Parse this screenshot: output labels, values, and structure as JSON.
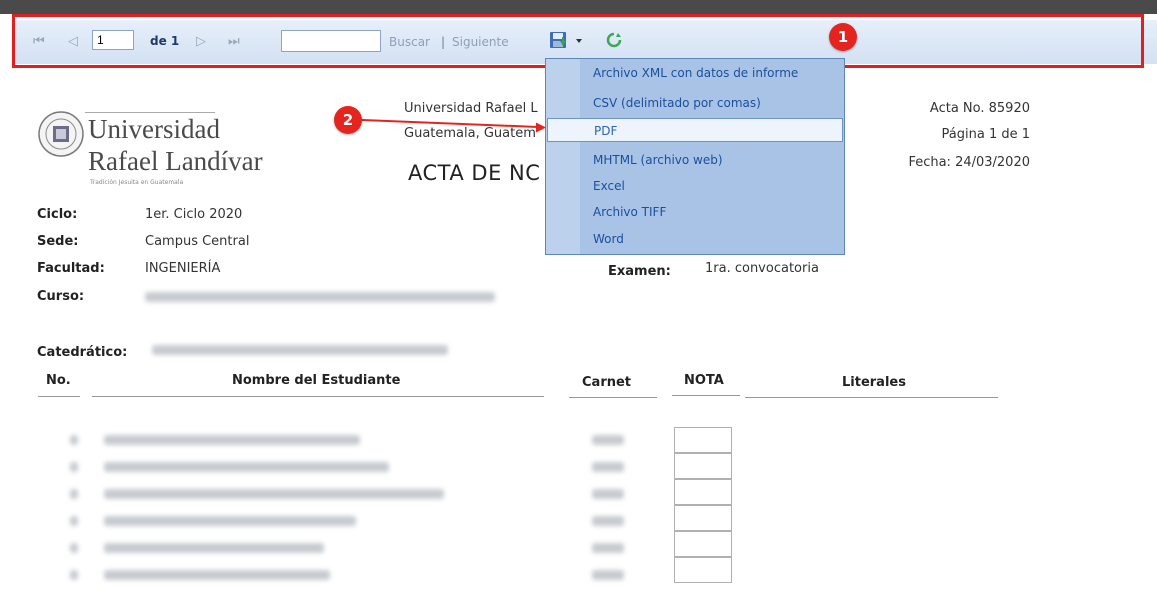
{
  "toolbar": {
    "page_value": "1",
    "page_of": "de 1",
    "search_placeholder": "",
    "find_label": "Buscar",
    "separator": "|",
    "next_label": "Siguiente"
  },
  "callouts": {
    "one": "1",
    "two": "2"
  },
  "export_menu": {
    "items": [
      "Archivo XML con datos de informe",
      "CSV (delimitado por comas)",
      "PDF",
      "MHTML (archivo web)",
      "Excel",
      "Archivo TIFF",
      "Word"
    ],
    "selected_index": 2
  },
  "report": {
    "university_line1": "Universidad",
    "university_line2": "Rafael Landívar",
    "university_tagline": "Tradición Jesuita en Guatemala",
    "inst_line1": "Universidad Rafael L",
    "inst_line2": "Guatemala, Guatem",
    "title": "ACTA DE NC",
    "acta_no": "Acta No. 85920",
    "pagina": "Página 1 de 1",
    "fecha": "Fecha: 24/03/2020",
    "ciclo_label": "Ciclo:",
    "ciclo_value": "1er. Ciclo 2020",
    "sede_label": "Sede:",
    "sede_value": "Campus Central",
    "facultad_label": "Facultad:",
    "facultad_value": "INGENIERÍA",
    "curso_label": "Curso:",
    "examen_label": "Examen:",
    "examen_value": "1ra. convocatoria",
    "catedratico_label": "Catedrático:",
    "columns": {
      "no": "No.",
      "nombre": "Nombre del Estudiante",
      "carnet": "Carnet",
      "nota": "NOTA",
      "literales": "Literales"
    }
  },
  "colors": {
    "toolbar_bg": "#dbe6f4",
    "callout_red": "#e4251f",
    "menu_bg": "#a8c3e6",
    "menu_text": "#1b4f9c"
  }
}
